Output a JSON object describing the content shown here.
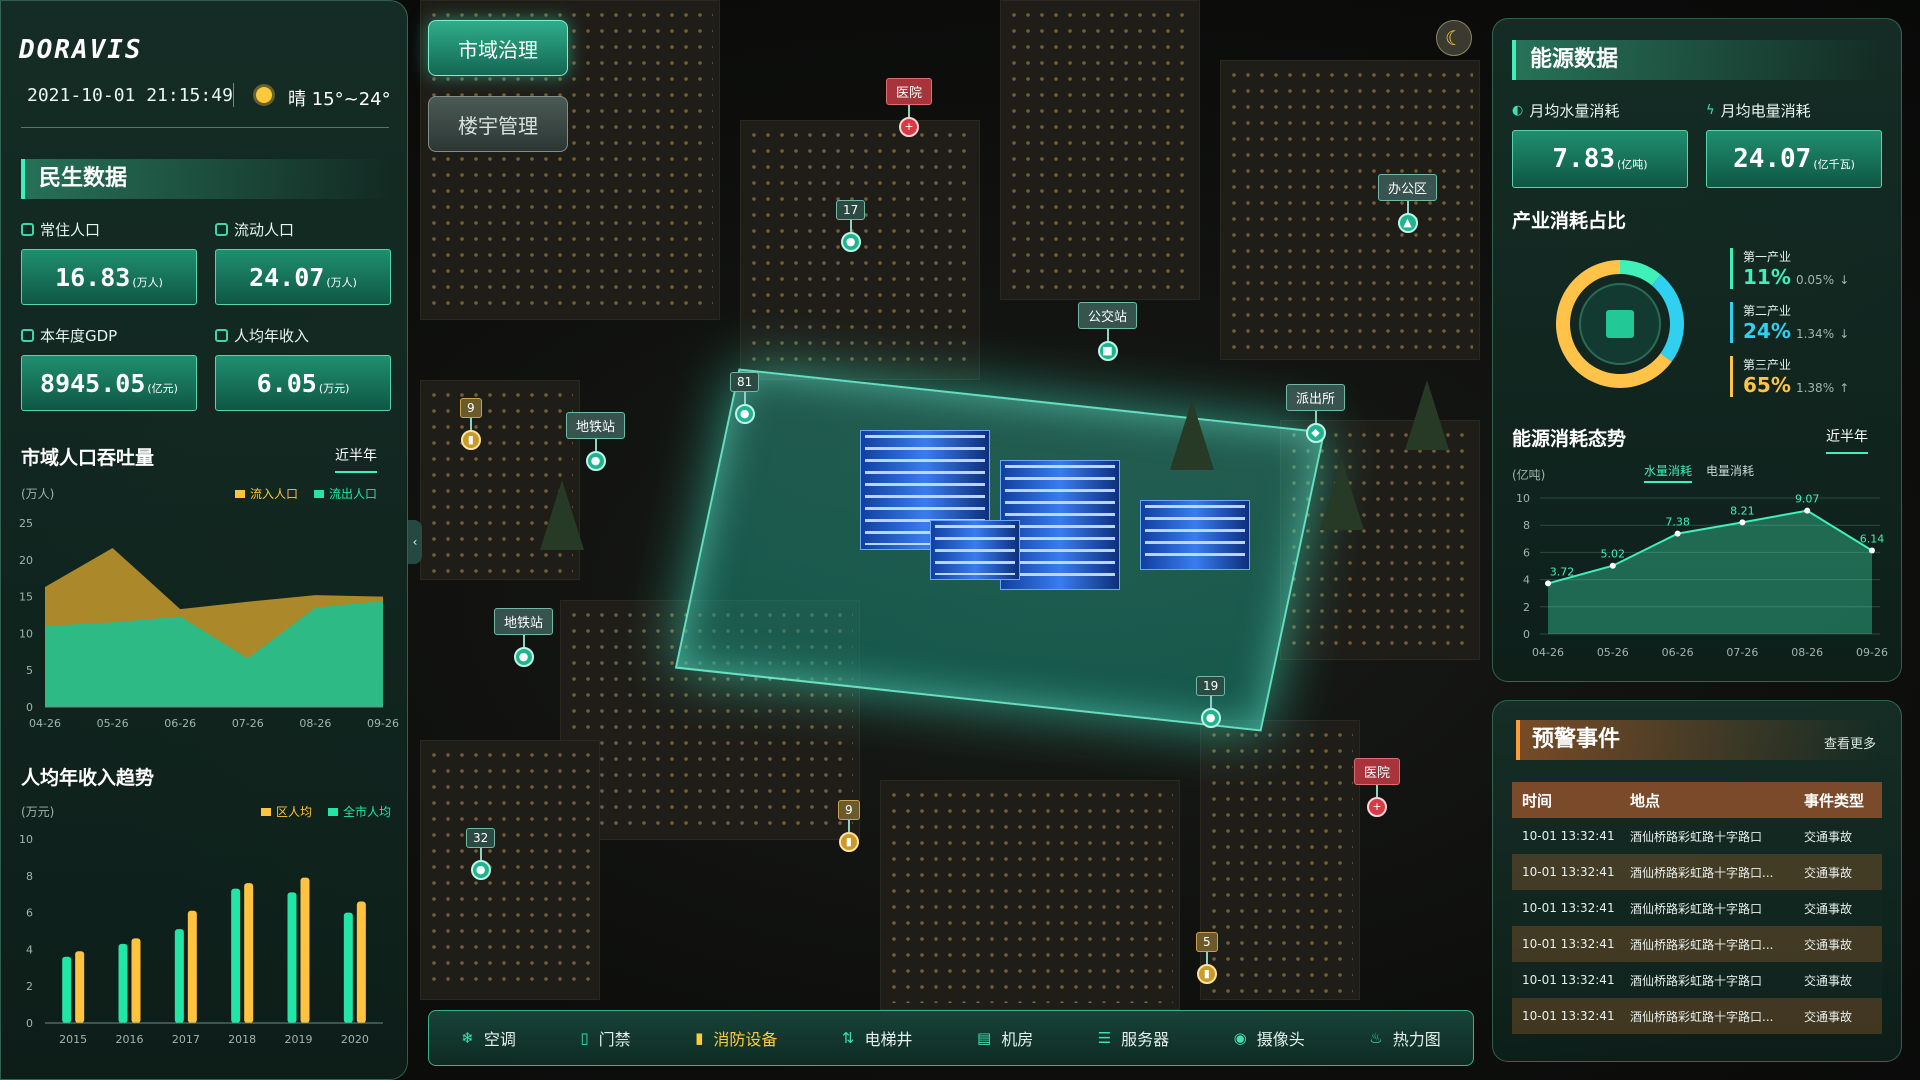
{
  "header": {
    "logo": "DORAVIS",
    "datetime": "2021-10-01 21:15:49",
    "weather": "晴 15°~24°"
  },
  "nav": {
    "city_governance": "市域治理",
    "building_mgmt": "楼宇管理"
  },
  "livelihood": {
    "title": "民生数据",
    "resident_label": "常住人口",
    "resident_value": "16.83",
    "resident_unit": "(万人)",
    "floating_label": "流动人口",
    "floating_value": "24.07",
    "floating_unit": "(万人)",
    "gdp_label": "本年度GDP",
    "gdp_value": "8945.05",
    "gdp_unit": "(亿元)",
    "income_label": "人均年收入",
    "income_value": "6.05",
    "income_unit": "(万元)"
  },
  "population_chart": {
    "title": "市域人口吞吐量",
    "range_label": "近半年",
    "unit": "(万人)",
    "legend_in": "流入人口",
    "legend_out": "流出人口"
  },
  "income_chart": {
    "title": "人均年收入趋势",
    "unit": "(万元)",
    "legend_district": "区人均",
    "legend_city": "全市人均"
  },
  "energy": {
    "title": "能源数据",
    "water_label": "月均水量消耗",
    "water_value": "7.83",
    "water_unit": "(亿吨)",
    "power_label": "月均电量消耗",
    "power_value": "24.07",
    "power_unit": "(亿千瓦)",
    "industry_title": "产业消耗占比",
    "industries": [
      {
        "name": "第一产业",
        "pct": "11%",
        "delta": "0.05%",
        "arrow": "↓",
        "color": "#3ff0b8"
      },
      {
        "name": "第二产业",
        "pct": "24%",
        "delta": "1.34%",
        "arrow": "↓",
        "color": "#2fd0f0"
      },
      {
        "name": "第三产业",
        "pct": "65%",
        "delta": "1.38%",
        "arrow": "↑",
        "color": "#ffc34a"
      }
    ],
    "trend_title": "能源消耗态势",
    "trend_range": "近半年",
    "trend_unit": "(亿吨)",
    "tab_water": "水量消耗",
    "tab_power": "电量消耗"
  },
  "alerts": {
    "title": "预警事件",
    "more": "查看更多",
    "headers": [
      "时间",
      "地点",
      "事件类型"
    ],
    "rows": [
      {
        "time": "10-01 13:32:41",
        "place": "酒仙桥路彩虹路十字路口",
        "type": "交通事故"
      },
      {
        "time": "10-01 13:32:41",
        "place": "酒仙桥路彩虹路十字路口...",
        "type": "交通事故"
      },
      {
        "time": "10-01 13:32:41",
        "place": "酒仙桥路彩虹路十字路口",
        "type": "交通事故"
      },
      {
        "time": "10-01 13:32:41",
        "place": "酒仙桥路彩虹路十字路口...",
        "type": "交通事故"
      },
      {
        "time": "10-01 13:32:41",
        "place": "酒仙桥路彩虹路十字路口",
        "type": "交通事故"
      },
      {
        "time": "10-01 13:32:41",
        "place": "酒仙桥路彩虹路十字路口...",
        "type": "交通事故"
      }
    ]
  },
  "toolbar": {
    "items": [
      "空调",
      "门禁",
      "消防设备",
      "电梯井",
      "机房",
      "服务器",
      "摄像头",
      "热力图"
    ]
  },
  "markers": {
    "hospital": "医院",
    "office": "办公区",
    "bus": "公交站",
    "police": "派出所",
    "metro": "地铁站",
    "n17": "17",
    "n81": "81",
    "n9": "9",
    "n19": "19",
    "n32": "32",
    "n5": "5"
  },
  "chart_data": [
    {
      "type": "area",
      "title": "市域人口吞吐量",
      "ylabel": "(万人)",
      "categories": [
        "04-26",
        "05-26",
        "06-26",
        "07-26",
        "08-26",
        "09-26"
      ],
      "ylim": [
        0,
        25
      ],
      "yticks": [
        0,
        5,
        10,
        15,
        20,
        25
      ],
      "series": [
        {
          "name": "流入人口",
          "values": [
            16.3,
            21.6,
            13.3,
            14.3,
            15.2,
            15.0
          ],
          "color": "#c79a2c"
        },
        {
          "name": "流出人口",
          "values": [
            11.0,
            11.5,
            12.3,
            6.6,
            13.5,
            14.4
          ],
          "color": "#1fc08f"
        }
      ],
      "legend": "top-right",
      "grid": false
    },
    {
      "type": "bar",
      "title": "人均年收入趋势",
      "ylabel": "(万元)",
      "categories": [
        "2015",
        "2016",
        "2017",
        "2018",
        "2019",
        "2020"
      ],
      "ylim": [
        0,
        10
      ],
      "yticks": [
        0,
        2,
        4,
        6,
        8,
        10
      ],
      "series": [
        {
          "name": "区人均",
          "values": [
            3.6,
            4.3,
            5.1,
            7.3,
            7.1,
            6.0
          ],
          "color": "#22e6a6"
        },
        {
          "name": "全市人均",
          "values": [
            3.9,
            4.6,
            6.1,
            7.6,
            7.9,
            6.6
          ],
          "color": "#ffc33f"
        }
      ],
      "legend": "top-right",
      "grid": false
    },
    {
      "type": "pie",
      "title": "产业消耗占比",
      "categories": [
        "第一产业",
        "第二产业",
        "第三产业"
      ],
      "values": [
        11,
        24,
        65
      ],
      "colors": [
        "#3ff0b8",
        "#2fd0f0",
        "#ffc34a"
      ]
    },
    {
      "type": "area",
      "title": "能源消耗态势",
      "ylabel": "(亿吨)",
      "categories": [
        "04-26",
        "05-26",
        "06-26",
        "07-26",
        "08-26",
        "09-26"
      ],
      "ylim": [
        0,
        10
      ],
      "yticks": [
        0,
        2,
        4,
        6,
        8,
        10
      ],
      "series": [
        {
          "name": "水量消耗",
          "values": [
            3.72,
            5.02,
            7.38,
            8.21,
            9.07,
            6.14
          ],
          "color": "#3ff0b8"
        }
      ],
      "data_labels": [
        "3.72",
        "5.02",
        "7.38",
        "8.21",
        "9.07",
        "6.14"
      ],
      "legend": "top",
      "grid": true
    }
  ]
}
